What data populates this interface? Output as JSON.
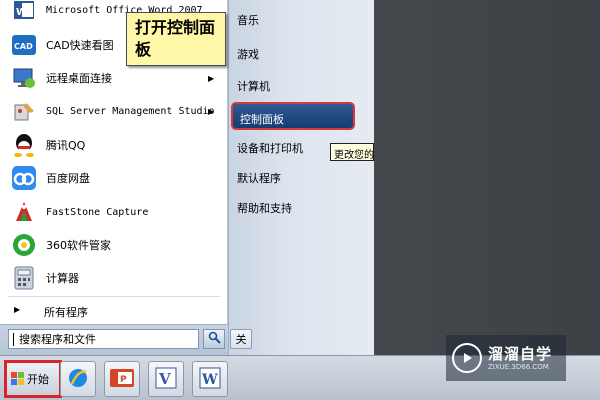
{
  "start_menu": {
    "programs": [
      {
        "label": "Microsoft Office Word 2007",
        "icon": "word-icon"
      },
      {
        "label": "CAD快速看图",
        "icon": "cad-icon"
      },
      {
        "label": "远程桌面连接",
        "icon": "remote-desktop-icon",
        "submenu": true
      },
      {
        "label": "SQL Server Management Studio",
        "icon": "sql-server-icon",
        "submenu": true
      },
      {
        "label": "腾讯QQ",
        "icon": "qq-icon"
      },
      {
        "label": "百度网盘",
        "icon": "baidu-netdisk-icon"
      },
      {
        "label": "FastStone Capture",
        "icon": "faststone-capture-icon"
      },
      {
        "label": "360软件管家",
        "icon": "360-software-manager-icon"
      },
      {
        "label": "计算器",
        "icon": "calculator-icon"
      }
    ],
    "all_programs_label": "所有程序",
    "search_value": "搜索程序和文件",
    "shutdown_label": "关",
    "right_items": [
      "音乐",
      "游戏",
      "计算机",
      "控制面板",
      "设备和打印机",
      "默认程序",
      "帮助和支持"
    ],
    "selected_item": "控制面板",
    "tooltip": "更改您的计算机设置",
    "callout_text": "打开控制面板"
  },
  "taskbar": {
    "start_label": "开始",
    "pinned": [
      "ie-icon",
      "powerpoint-icon",
      "visio-icon",
      "word-icon"
    ]
  },
  "watermark": {
    "title": "溜溜自学",
    "url": "ZIXUE.3D66.COM"
  },
  "colors": {
    "selection": "#173d72",
    "highlight_border": "#d4393f",
    "callout": "#fff7a8"
  }
}
